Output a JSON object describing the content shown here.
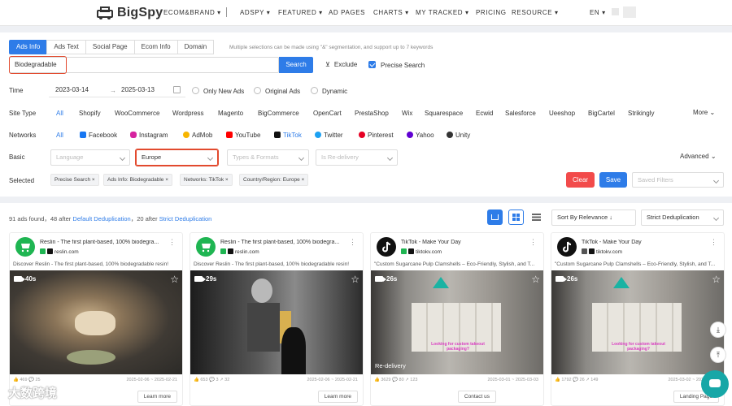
{
  "nav": {
    "logo": "BigSpy",
    "items": [
      "ECOM&BRAND ▾",
      "ADSPY ▾",
      "FEATURED ▾",
      "AD PAGES",
      "CHARTS ▾",
      "MY TRACKED ▾",
      "PRICING",
      "RESOURCE ▾"
    ],
    "lang": "EN ▾"
  },
  "tabs": [
    "Ads Info",
    "Ads Text",
    "Social Page",
    "Ecom Info",
    "Domain"
  ],
  "hint": "Multiple selections can be made using \"&\" segmentation, and support up to 7 keywords",
  "search": {
    "value": "Biodegradable",
    "button": "Search",
    "exclude": "Exclude",
    "precise": "Precise Search"
  },
  "time": {
    "label": "Time",
    "start": "2023-03-14",
    "sep": "→",
    "end": "2025-03-13",
    "options": [
      "Only New Ads",
      "Original Ads",
      "Dynamic"
    ]
  },
  "site_type": {
    "label": "Site Type",
    "items": [
      "All",
      "Shopify",
      "WooCommerce",
      "Wordpress",
      "Magento",
      "BigCommerce",
      "OpenCart",
      "PrestaShop",
      "Wix",
      "Squarespace",
      "Ecwid",
      "Salesforce",
      "Ueeshop",
      "BigCartel",
      "Strikingly"
    ],
    "more": "More"
  },
  "networks": {
    "label": "Networks",
    "items": [
      "All",
      "Facebook",
      "Instagram",
      "AdMob",
      "YouTube",
      "TikTok",
      "Twitter",
      "Pinterest",
      "Yahoo",
      "Unity"
    ],
    "selected": "TikTok"
  },
  "basic": {
    "label": "Basic",
    "language": "Language",
    "region": "Europe",
    "types": "Types & Formats",
    "redelivery": "Is Re-delivery",
    "advanced": "Advanced"
  },
  "selected": {
    "label": "Selected",
    "tags": [
      "Precise Search ×",
      "Ads Info: Biodegradable ×",
      "Networks: TikTok ×",
      "Country/Region: Europe ×"
    ],
    "clear": "Clear",
    "save": "Save",
    "saved_filters": "Saved Filters"
  },
  "results": {
    "count_prefix": "91 ads found，",
    "after1_num": "48 after",
    "after1_link": "Default Deduplication",
    "after2_num": "，20 after",
    "after2_link": "Strict Deduplication",
    "sort": "Sort By Relevance ↓",
    "dedup": "Strict Deduplication"
  },
  "cards": [
    {
      "title": "Reslin - The first plant-based, 100% biodegra...",
      "domain": "reslin.com",
      "desc": "Discover Reslin - The first plant-based, 100% biodegradable resin!",
      "duration": "40s",
      "stats": "👍 469  💬 25",
      "dates": "2025-02-06 ~ 2025-02-21",
      "button": "Learn more",
      "redelivery": ""
    },
    {
      "title": "Reslin - The first plant-based, 100% biodegra...",
      "domain": "reslin.com",
      "desc": "Discover Reslin - The first plant-based, 100% biodegradable resin!",
      "duration": "29s",
      "stats": "👍 653  💬 3  ↗ 32",
      "dates": "2025-02-06 ~ 2025-02-21",
      "button": "Learn more",
      "redelivery": ""
    },
    {
      "title": "TikTok - Make Your Day",
      "domain": "tiktokv.com",
      "desc": "\"Custom Sugarcane Pulp Clamshells – Eco-Friendly, Stylish, and T...",
      "duration": "26s",
      "stats": "👍 3629  💬 80  ↗ 123",
      "dates": "2025-03-01 ~ 2025-03-03",
      "button": "Contact us",
      "redelivery": "Re-delivery"
    },
    {
      "title": "TikTok - Make Your Day",
      "domain": "tiktokv.com",
      "desc": "\"Custom Sugarcane Pulp Clamshells – Eco-Friendly, Stylish, and T...",
      "duration": "26s",
      "stats": "👍 1792  💬 26  ↗ 149",
      "dates": "2025-03-02 ~ 2025-03-02",
      "button": "Landing Page",
      "redelivery": ""
    }
  ],
  "watermark": "大数跨境",
  "colors": {
    "accent": "#2e7ce8",
    "danger": "#f24b4b",
    "highlight": "#e24a2e"
  }
}
